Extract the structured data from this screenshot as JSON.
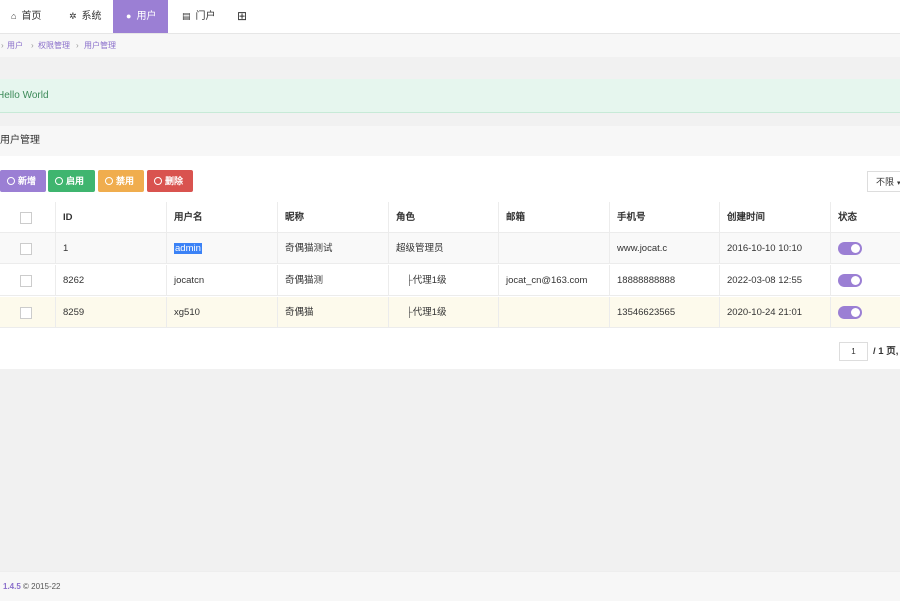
{
  "nav": {
    "items": [
      {
        "label": "首页",
        "icon": "home-icon",
        "glyph": "⌂"
      },
      {
        "label": "系统",
        "icon": "gear-icon",
        "glyph": "✲"
      },
      {
        "label": "用户",
        "icon": "user-icon",
        "glyph": "●"
      },
      {
        "label": "门户",
        "icon": "portal-icon",
        "glyph": "▤"
      }
    ],
    "extra_icon": "grid-icon",
    "extra_glyph": "⊞",
    "active_index": 2,
    "accent_color": "#9b7fd4"
  },
  "breadcrumb": [
    "用户",
    "权限管理",
    "用户管理"
  ],
  "alert": {
    "text": "Hello World"
  },
  "panel": {
    "title": "用户管理"
  },
  "toolbar": {
    "add_label": "新增",
    "enable_label": "启用",
    "disable_label": "禁用",
    "delete_label": "删除",
    "filter_label": "不限"
  },
  "table": {
    "headers": [
      "ID",
      "用户名",
      "昵称",
      "角色",
      "邮箱",
      "手机号",
      "创建时间",
      "状态"
    ],
    "rows": [
      {
        "id": "1",
        "username": "admin",
        "nickname": "奇偶猫测试",
        "role": "超级管理员",
        "email": "",
        "phone": "www.jocat.c",
        "created": "2016-10-10 10:10",
        "status": "on"
      },
      {
        "id": "8262",
        "username": "jocatcn",
        "nickname": "奇偶猫测",
        "role": "代理1级",
        "email": "jocat_cn@163.com",
        "phone": "18888888888",
        "created": "2022-03-08 12:55",
        "status": "on"
      },
      {
        "id": "8259",
        "username": "xg510",
        "nickname": "奇偶猫",
        "role": "代理1级",
        "email": "",
        "phone": "13546623565",
        "created": "2020-10-24 21:01",
        "status": "on"
      }
    ]
  },
  "pagination": {
    "page": "1",
    "suffix": "/ 1 页,"
  },
  "footer": {
    "version": "1.4.5",
    "copyright": "© 2015-22"
  }
}
